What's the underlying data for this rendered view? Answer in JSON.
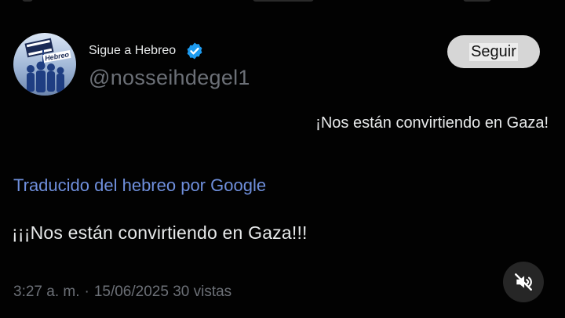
{
  "profile": {
    "avatar_text": "Hebreo",
    "name_label": "Sigue a Hebreo",
    "handle": "@nosseihdegel1",
    "follow_label": "Seguir"
  },
  "tweet": {
    "original_text": "¡Nos están convirtiendo en Gaza!",
    "translation_note": "Traducido del hebreo por Google",
    "translated_text": "¡¡¡Nos están convirtiendo en Gaza!!!"
  },
  "meta": {
    "time": "3:27 a. m.",
    "separator": "·",
    "date": "15/06/2025",
    "views": "30 vistas"
  },
  "colors": {
    "background": "#020202",
    "link": "#6f8fdc",
    "verified": "#1d9bf0",
    "muted_text": "#6c7077"
  },
  "icons": {
    "verified": "verified-badge-icon",
    "mute": "speaker-muted-icon"
  }
}
